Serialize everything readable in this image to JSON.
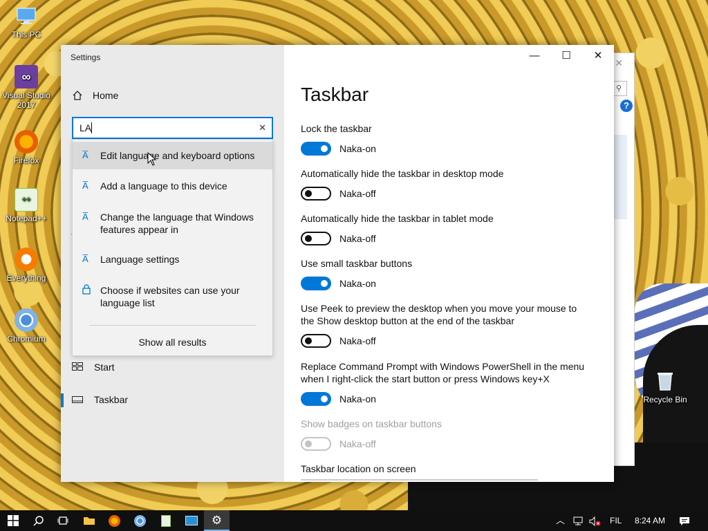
{
  "desktop": {
    "icons": [
      {
        "label": "This PC",
        "icon": "computer-icon",
        "color": "#3b8ede"
      },
      {
        "label": "Visual Studio 2017",
        "icon": "visual-studio-icon",
        "color": "#6b3fa0"
      },
      {
        "label": "Firefox",
        "icon": "firefox-icon",
        "color": "#e66000"
      },
      {
        "label": "Notepad++",
        "icon": "notepad-plus-plus-icon",
        "color": "#8bc34a"
      },
      {
        "label": "Everything",
        "icon": "everything-search-icon",
        "color": "#f57c00"
      },
      {
        "label": "Chromium",
        "icon": "chromium-icon",
        "color": "#4a90d9"
      },
      {
        "label": "Recycle Bin",
        "icon": "recycle-bin-icon",
        "color": "#9aa8b8"
      }
    ]
  },
  "settings": {
    "app_title": "Settings",
    "home_label": "Home",
    "search": {
      "value": "LA",
      "results": [
        {
          "label": "Edit language and keyboard options",
          "icon": "language-icon"
        },
        {
          "label": "Add a language to this device",
          "icon": "language-icon"
        },
        {
          "label": "Change the language that Windows features appear in",
          "icon": "language-icon"
        },
        {
          "label": "Language settings",
          "icon": "language-icon"
        },
        {
          "label": "Choose if websites can use your language list",
          "icon": "lock-icon"
        }
      ],
      "show_all": "Show all results"
    },
    "nav": {
      "start": "Start",
      "taskbar": "Taskbar"
    },
    "page_title": "Taskbar",
    "options": [
      {
        "label": "Lock the taskbar",
        "state": "Naka-on",
        "on": true,
        "disabled": false
      },
      {
        "label": "Automatically hide the taskbar in desktop mode",
        "state": "Naka-off",
        "on": false,
        "disabled": false
      },
      {
        "label": "Automatically hide the taskbar in tablet mode",
        "state": "Naka-off",
        "on": false,
        "disabled": false
      },
      {
        "label": "Use small taskbar buttons",
        "state": "Naka-on",
        "on": true,
        "disabled": false
      },
      {
        "label": "Use Peek to preview the desktop when you move your mouse to the Show desktop button at the end of the taskbar",
        "state": "Naka-off",
        "on": false,
        "disabled": false
      },
      {
        "label": "Replace Command Prompt with Windows PowerShell in the menu when I right-click the start button or press Windows key+X",
        "state": "Naka-on",
        "on": true,
        "disabled": false
      },
      {
        "label": "Show badges on taskbar buttons",
        "state": "Naka-off",
        "on": false,
        "disabled": true
      }
    ],
    "location_label": "Taskbar location on screen",
    "accent_color": "#0078d7"
  },
  "taskbar": {
    "language": "FIL",
    "time": "8:24 AM"
  }
}
